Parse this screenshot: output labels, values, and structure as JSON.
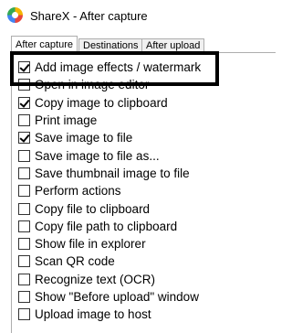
{
  "window": {
    "title": "ShareX - After capture",
    "icon": "sharex-icon"
  },
  "tabs": [
    {
      "label": "After capture",
      "active": true
    },
    {
      "label": "Destinations",
      "active": false
    },
    {
      "label": "After upload",
      "active": false
    }
  ],
  "options": [
    {
      "label": "Add image effects / watermark",
      "checked": true
    },
    {
      "label": "Open in image editor",
      "checked": false
    },
    {
      "label": "Copy image to clipboard",
      "checked": true
    },
    {
      "label": "Print image",
      "checked": false
    },
    {
      "label": "Save image to file",
      "checked": true
    },
    {
      "label": "Save image to file as...",
      "checked": false
    },
    {
      "label": "Save thumbnail image to file",
      "checked": false
    },
    {
      "label": "Perform actions",
      "checked": false
    },
    {
      "label": "Copy file to clipboard",
      "checked": false
    },
    {
      "label": "Copy file path to clipboard",
      "checked": false
    },
    {
      "label": "Show file in explorer",
      "checked": false
    },
    {
      "label": "Scan QR code",
      "checked": false
    },
    {
      "label": "Recognize text (OCR)",
      "checked": false
    },
    {
      "label": "Show \"Before upload\" window",
      "checked": false
    },
    {
      "label": "Upload image to host",
      "checked": false
    }
  ]
}
